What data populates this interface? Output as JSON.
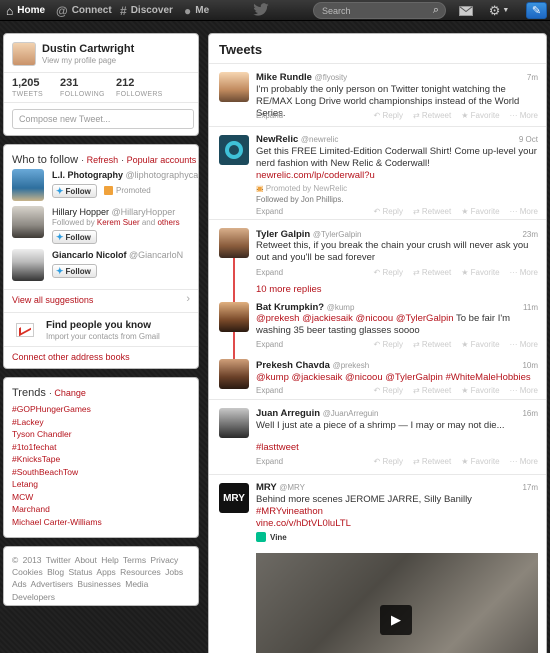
{
  "nav": {
    "home": "Home",
    "connect": "Connect",
    "discover": "Discover",
    "me": "Me",
    "search_placeholder": "Search"
  },
  "profile": {
    "name": "Dustin Cartwright",
    "view_profile": "View my profile page",
    "stats": [
      {
        "value": "1,205",
        "label": "TWEETS"
      },
      {
        "value": "231",
        "label": "FOLLOWING"
      },
      {
        "value": "212",
        "label": "FOLLOWERS"
      }
    ],
    "compose_placeholder": "Compose new Tweet..."
  },
  "who_to_follow": {
    "title": "Who to follow",
    "refresh": "Refresh",
    "popular": "Popular accounts",
    "follow_label": "Follow",
    "suggestions": [
      {
        "name": "L.I. Photography",
        "handle": "@liphotographyca",
        "note": "Promoted"
      },
      {
        "name": "Hillary Hopper",
        "handle": "@HillaryHopper",
        "followed_prefix": "Followed by",
        "followed_name": "Kerem Suer",
        "followed_and": "and",
        "followed_others": "others"
      },
      {
        "name": "Giancarlo Nicolof",
        "handle": "@GiancarloN"
      }
    ],
    "view_all": "View all suggestions",
    "find_title": "Find people you know",
    "find_sub": "Import your contacts from Gmail",
    "connect_books": "Connect other address books"
  },
  "trends": {
    "title": "Trends",
    "change": "Change",
    "items": [
      "#GOPHungerGames",
      "#Lackey",
      "Tyson Chandler",
      "#1to1fechat",
      "#KnicksTape",
      "#SouthBeachTow",
      "Letang",
      "MCW",
      "Marchand",
      "Michael Carter-Williams"
    ]
  },
  "footer": {
    "text": "© 2013 Twitter  About  Help  Terms  Privacy  Cookies  Blog  Status  Apps  Resources  Jobs  Ads  Advertisers  Businesses  Media  Developers"
  },
  "timeline": {
    "title": "Tweets",
    "expand": "Expand",
    "actions": {
      "reply": "Reply",
      "retweet": "Retweet",
      "favorite": "Favorite",
      "more": "More"
    },
    "tweets": [
      {
        "name": "Mike Rundle",
        "handle": "@flyosity",
        "time": "7m",
        "text": "I'm probably the only person on Twitter tonight watching the RE/MAX Long Drive world championships instead of the World Series."
      },
      {
        "name": "NewRelic",
        "handle": "@newrelic",
        "time": "9 Oct",
        "text": "Get this FREE Limited-Edition Coderwall Shirt! Come up-level your nerd fashion with New Relic & Coderwall! ",
        "link": "newrelic.com/lp/coderwall?u",
        "ellipsis": "...",
        "promoted": "Promoted by NewRelic",
        "followed": "Followed by Jon Phillips."
      },
      {
        "name": "Tyler Galpin",
        "handle": "@TylerGalpin",
        "time": "23m",
        "text": "Retweet this, if you break the chain your crush will never ask you out and you'll be sad forever",
        "more_replies": "10 more replies"
      },
      {
        "name": "Bat Krumpkin?",
        "handle": "@kump",
        "time": "11m",
        "mentions": "@prekesh @jackiesaik @nicoou @TylerGalpin",
        "text": " To be fair I'm washing 35 beer tasting glasses soooo"
      },
      {
        "name": "Prekesh Chavda",
        "handle": "@prekesh",
        "time": "10m",
        "mentions": "@kump @jackiesaik @nicoou @TylerGalpin #WhiteMaleHobbies"
      },
      {
        "name": "Juan Arreguin",
        "handle": "@JuanArreguin",
        "time": "16m",
        "text": "Well I just ate a piece of a shrimp — I may or may not die...",
        "hashtag": "#lasttweet"
      },
      {
        "name": "MRY",
        "handle": "@MRY",
        "time": "17m",
        "avatar_text": "MRY",
        "text": "Behind more scenes JEROME JARRE, Silly Banilly ",
        "hashtag": "#MRYvineathon",
        "link": "vine.co/v/hDtVL0luLTL",
        "vine": "Vine"
      }
    ]
  },
  "colors": {
    "accent": "#b5121b",
    "thread": "#e04b4b",
    "vine": "#00bf8f",
    "compose": "#2a7fd4"
  }
}
